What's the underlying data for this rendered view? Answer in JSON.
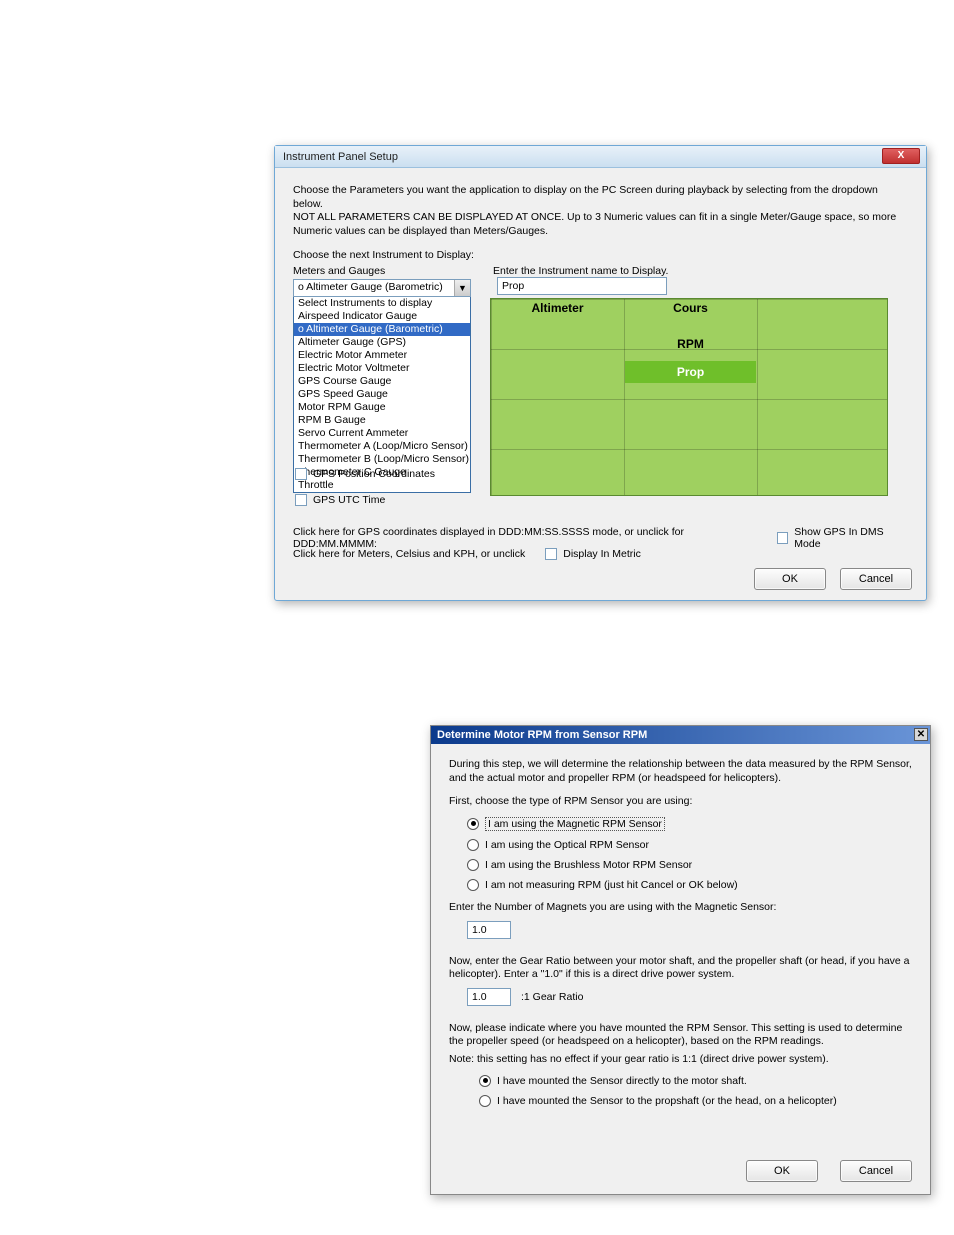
{
  "dlg1": {
    "title": "Instrument Panel Setup",
    "intro1": "Choose the Parameters  you want the application to display on the PC Screen during playback by selecting from the dropdown below.",
    "intro2": "NOT ALL PARAMETERS CAN BE DISPLAYED AT ONCE.  Up to 3 Numeric values can fit in a single Meter/Gauge space, so more Numeric values can be displayed than Meters/Gauges.",
    "choose_next": "Choose the next Instrument to Display:",
    "meters_label": "Meters and Gauges",
    "enter_name": "Enter the Instrument name to Display.",
    "selected_option": "o Altimeter Gauge (Barometric)",
    "prop_value": "Prop",
    "dropdown_header": "Select Instruments to display",
    "dropdown_items": [
      "Airspeed Indicator Gauge",
      "o Altimeter Gauge (Barometric)",
      "Altimeter Gauge (GPS)",
      "Electric Motor Ammeter",
      "Electric Motor Voltmeter",
      "GPS Course Gauge",
      "GPS Speed Gauge",
      "Motor RPM Gauge",
      "RPM B Gauge",
      "Servo Current Ammeter",
      "Thermometer A (Loop/Micro Sensor)",
      "Thermometer B (Loop/Micro Sensor)",
      "Thermometer C Gauge",
      "Throttle"
    ],
    "grid": {
      "altimeter": "Altimeter",
      "cours": "Cours",
      "rpm": "RPM",
      "prop": "Prop"
    },
    "gps_pos": "GPS Position Coordinates",
    "gps_utc": "GPS UTC Time",
    "gps_dms_text": "Click here for GPS coordinates displayed in DDD:MM:SS.SSSS mode, or unclick for DDD:MM.MMMM:",
    "gps_dms_chk": "Show GPS In DMS Mode",
    "metric_text": "Click here for Meters, Celsius and KPH, or unclick",
    "metric_chk": "Display In Metric",
    "ok": "OK",
    "cancel": "Cancel"
  },
  "dlg2": {
    "title": "Determine Motor RPM from Sensor RPM",
    "p1": "During this step, we will determine the relationship between the data measured by the RPM Sensor, and the actual motor and propeller RPM (or headspeed for helicopters).",
    "p2": "First, choose the type of RPM Sensor you are using:",
    "r1": "I am using the Magnetic RPM Sensor",
    "r2": "I am using the Optical RPM Sensor",
    "r3": "I am using the Brushless Motor RPM Sensor",
    "r4": "I am not measuring RPM (just hit Cancel or OK below)",
    "magnets_label": "Enter the Number of Magnets you are using with the Magnetic Sensor:",
    "magnets_value": "1.0",
    "gear_text": "Now, enter the Gear Ratio between your motor shaft, and the propeller shaft (or head, if you have a helicopter).    Enter a \"1.0\" if this is a direct drive power system.",
    "gear_value": "1.0",
    "gear_label": ":1 Gear Ratio",
    "mount_text": "Now, please indicate where you have mounted the RPM Sensor.   This setting is used to determine the propeller speed (or headspeed on a helicopter), based on the RPM readings.",
    "mount_note": "Note: this setting has no effect if your gear ratio is 1:1 (direct drive power system).",
    "m1": "I have mounted the Sensor directly to the motor shaft.",
    "m2": "I have mounted the Sensor to the propshaft (or the head, on a helicopter)",
    "ok": "OK",
    "cancel": "Cancel"
  }
}
